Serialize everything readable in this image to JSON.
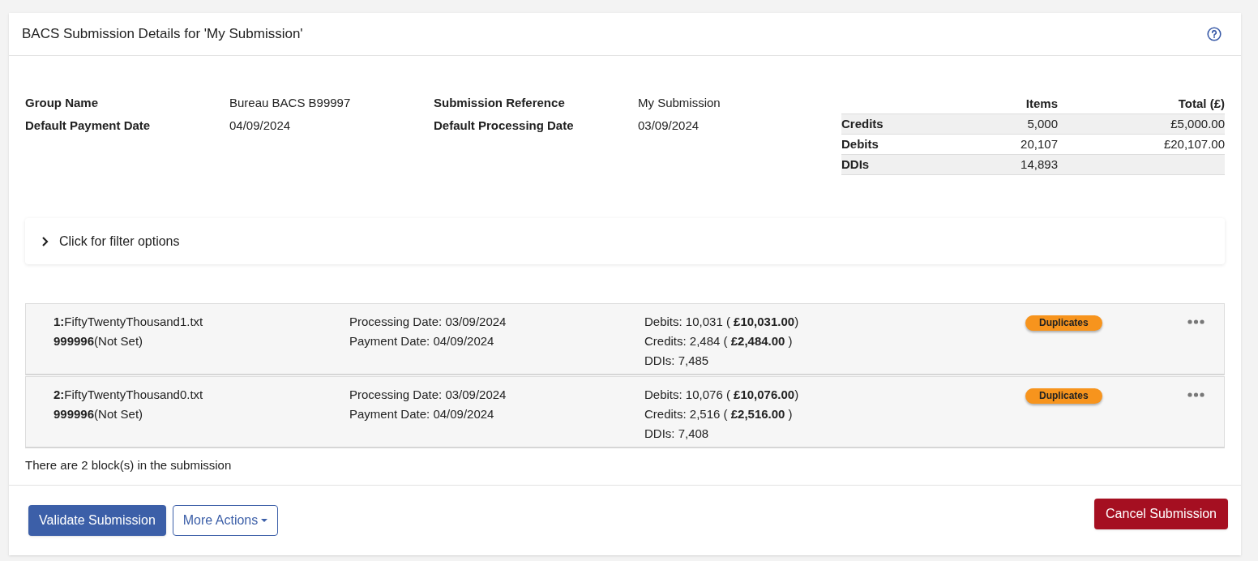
{
  "title": "BACS Submission Details for 'My Submission'",
  "details": [
    {
      "label": "Group Name",
      "value": "Bureau BACS B99997"
    },
    {
      "label": "Default Payment Date",
      "value": "04/09/2024"
    },
    {
      "label": "Submission Reference",
      "value": "My Submission"
    },
    {
      "label": "Default Processing Date",
      "value": "03/09/2024"
    }
  ],
  "summary": {
    "columns": [
      "Items",
      "Total (£)"
    ],
    "rows": [
      {
        "label": "Credits",
        "items": "5,000",
        "total": "£5,000.00"
      },
      {
        "label": "Debits",
        "items": "20,107",
        "total": "£20,107.00"
      },
      {
        "label": "DDIs",
        "items": "14,893"
      }
    ]
  },
  "filter": {
    "label": "Click for filter options",
    "expanded": false
  },
  "blocks": [
    {
      "name": "**1:**FiftyTwentyThousand1.txt",
      "sun": "**999996**(Not Set)",
      "dates": [
        "Processing Date: 03/09/2024",
        "Payment Date: 04/09/2024"
      ],
      "totals": [
        "Debits: 10,031 ( **£10,031.00**)",
        "Credits: 2,484 ( **£2,484.00** )",
        "DDIs: 7,485"
      ],
      "badge": "Duplicates"
    },
    {
      "name": "**2:**FiftyTwentyThousand0.txt",
      "sun": "**999996**(Not Set)",
      "dates": [
        "Processing Date: 03/09/2024",
        "Payment Date: 04/09/2024"
      ],
      "totals": [
        "Debits: 10,076 ( **£10,076.00**)",
        "Credits: 2,516 ( **£2,516.00** )",
        "DDIs: 7,408"
      ],
      "badge": "Duplicates"
    }
  ],
  "block_count": "There are 2 block(s) in the submission",
  "buttons": {
    "validate": "Validate Submission",
    "more": "More Actions",
    "cancel": "Cancel Submission"
  }
}
